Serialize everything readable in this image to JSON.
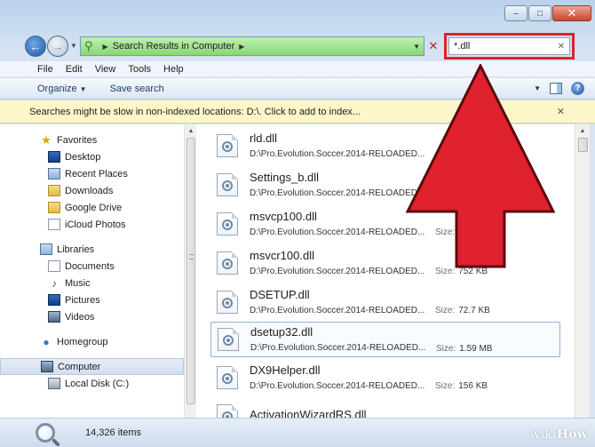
{
  "window": {
    "caption": {
      "minimize": "‒",
      "maximize": "□",
      "close": "✕"
    }
  },
  "address_bar": {
    "location": "Search Results in Computer",
    "search_value": "*.dll"
  },
  "menu": [
    "File",
    "Edit",
    "View",
    "Tools",
    "Help"
  ],
  "commands": {
    "organize": "Organize",
    "save_search": "Save search"
  },
  "infobar": {
    "text": "Searches might be slow in non-indexed locations: D:\\. Click to add to index...",
    "close": "✕"
  },
  "nav": {
    "favorites": {
      "label": "Favorites",
      "items": [
        "Desktop",
        "Recent Places",
        "Downloads",
        "Google Drive",
        "iCloud Photos"
      ]
    },
    "libraries": {
      "label": "Libraries",
      "items": [
        "Documents",
        "Music",
        "Pictures",
        "Videos"
      ]
    },
    "homegroup": "Homegroup",
    "computer": {
      "label": "Computer",
      "items": [
        "Local Disk (C:)"
      ]
    }
  },
  "results": {
    "size_label": "Size:",
    "items": [
      {
        "name": "rld.dll",
        "path": "D:\\Pro.Evolution.Soccer.2014-RELOADED...",
        "size": ""
      },
      {
        "name": "Settings_b.dll",
        "path": "D:\\Pro.Evolution.Soccer.2014-RELOADED...",
        "size": ""
      },
      {
        "name": "msvcp100.dll",
        "path": "D:\\Pro.Evolution.Soccer.2014-RELOADED...",
        "size": ""
      },
      {
        "name": "msvcr100.dll",
        "path": "D:\\Pro.Evolution.Soccer.2014-RELOADED...",
        "size": "752 KB"
      },
      {
        "name": "DSETUP.dll",
        "path": "D:\\Pro.Evolution.Soccer.2014-RELOADED...",
        "size": "72.7 KB"
      },
      {
        "name": "dsetup32.dll",
        "path": "D:\\Pro.Evolution.Soccer.2014-RELOADED...",
        "size": "1.59 MB"
      },
      {
        "name": "DX9Helper.dll",
        "path": "D:\\Pro.Evolution.Soccer.2014-RELOADED...",
        "size": "156 KB"
      },
      {
        "name": "ActivationWizardRS.dll",
        "path": "",
        "size": ""
      }
    ]
  },
  "status": {
    "count": "14,326 items"
  },
  "watermark": {
    "wiki": "wiki",
    "how": "How"
  },
  "colors": {
    "highlight_red": "#e0212e",
    "address_green": "#85d86f",
    "infobar": "#fcf7c9"
  }
}
